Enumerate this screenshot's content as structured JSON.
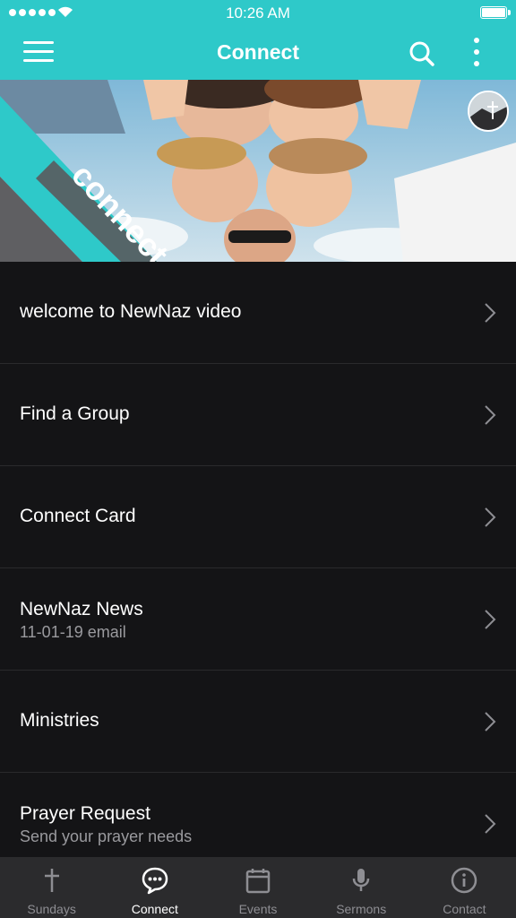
{
  "status_bar": {
    "time": "10:26 AM"
  },
  "header": {
    "title": "Connect"
  },
  "hero": {
    "banner_text": "connect"
  },
  "list": {
    "items": [
      {
        "title": "welcome to NewNaz video",
        "subtitle": ""
      },
      {
        "title": "Find a Group",
        "subtitle": ""
      },
      {
        "title": "Connect Card",
        "subtitle": ""
      },
      {
        "title": "NewNaz News",
        "subtitle": "11-01-19 email"
      },
      {
        "title": "Ministries",
        "subtitle": ""
      },
      {
        "title": "Prayer Request",
        "subtitle": "Send your prayer needs"
      }
    ]
  },
  "tabs": [
    {
      "label": "Sundays",
      "icon": "cross-icon",
      "active": false
    },
    {
      "label": "Connect",
      "icon": "chat-bubble-icon",
      "active": true
    },
    {
      "label": "Events",
      "icon": "calendar-icon",
      "active": false
    },
    {
      "label": "Sermons",
      "icon": "microphone-icon",
      "active": false
    },
    {
      "label": "Contact",
      "icon": "info-icon",
      "active": false
    }
  ],
  "colors": {
    "accent": "#2ec9c9",
    "background": "#141416",
    "tabbar": "#2b2b2d",
    "subtitle": "#9a9a9e"
  }
}
